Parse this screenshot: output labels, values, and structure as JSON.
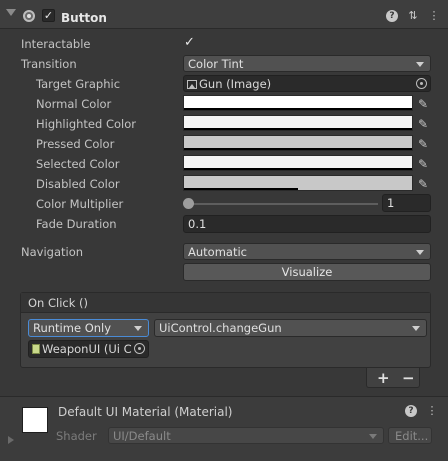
{
  "header": {
    "title": "Button",
    "enabled": true
  },
  "interactable": {
    "label": "Interactable",
    "checked": true
  },
  "transition": {
    "label": "Transition",
    "value": "Color Tint"
  },
  "target_graphic": {
    "label": "Target Graphic",
    "value": "Gun (Image)"
  },
  "colors": [
    {
      "label": "Normal Color",
      "color": "#FFFFFF",
      "alpha_fraction": 1.0
    },
    {
      "label": "Highlighted Color",
      "color": "#F5F5F5",
      "alpha_fraction": 1.0
    },
    {
      "label": "Pressed Color",
      "color": "#C8C8C8",
      "alpha_fraction": 1.0
    },
    {
      "label": "Selected Color",
      "color": "#F5F5F5",
      "alpha_fraction": 1.0
    },
    {
      "label": "Disabled Color",
      "color": "#C8C8C8",
      "alpha_fraction": 0.5
    }
  ],
  "color_multiplier": {
    "label": "Color Multiplier",
    "value": "1",
    "slider_fraction": 0.0
  },
  "fade_duration": {
    "label": "Fade Duration",
    "value": "0.1"
  },
  "navigation": {
    "label": "Navigation",
    "value": "Automatic"
  },
  "visualize": {
    "label": "Visualize"
  },
  "on_click": {
    "title": "On Click ()",
    "runtime": "Runtime Only",
    "function": "UiControl.changeGun",
    "object": "WeaponUI (Ui C"
  },
  "list_buttons": {
    "add": "+",
    "remove": "−"
  },
  "material": {
    "title": "Default UI Material (Material)",
    "shader_label": "Shader",
    "shader_value": "UI/Default",
    "edit_label": "Edit..."
  },
  "theme": {
    "panel": "#383838",
    "field": "#2A2A2A",
    "dropdown": "#515151",
    "text": "#C4C4C4"
  }
}
